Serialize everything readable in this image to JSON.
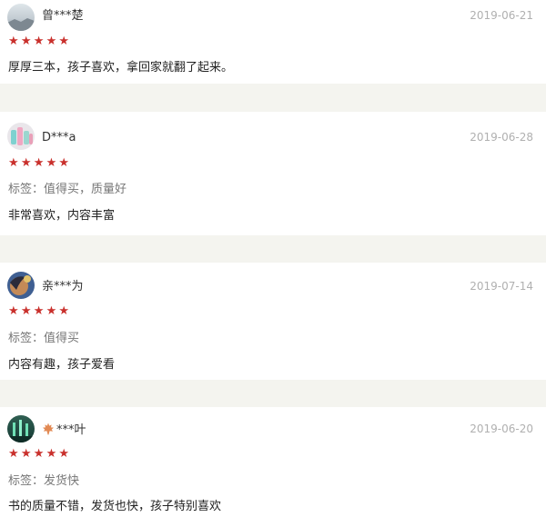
{
  "reviews": [
    {
      "username": "曾***楚",
      "date": "2019-06-21",
      "stars": "★★★★★",
      "rating": 5,
      "content": "厚厚三本，孩子喜欢，拿回家就翻了起来。"
    },
    {
      "username": "D***a",
      "date": "2019-06-28",
      "stars": "★★★★★",
      "rating": 5,
      "tags": "标签：值得买，质量好",
      "content": "非常喜欢，内容丰富"
    },
    {
      "username": "亲***为",
      "date": "2019-07-14",
      "stars": "★★★★★",
      "rating": 5,
      "tags": "标签：值得买",
      "content": "内容有趣，孩子爱看"
    },
    {
      "username": "***叶",
      "date": "2019-06-20",
      "stars": "★★★★★",
      "rating": 5,
      "tags": "标签：发货快",
      "content": "书的质量不错，发货也快，孩子特别喜欢"
    }
  ],
  "colors": {
    "star": "#c9302c",
    "date": "#b0b0b0",
    "separator": "#f4f4ef"
  },
  "icons": {
    "username_prefix": "maple-leaf-icon"
  }
}
